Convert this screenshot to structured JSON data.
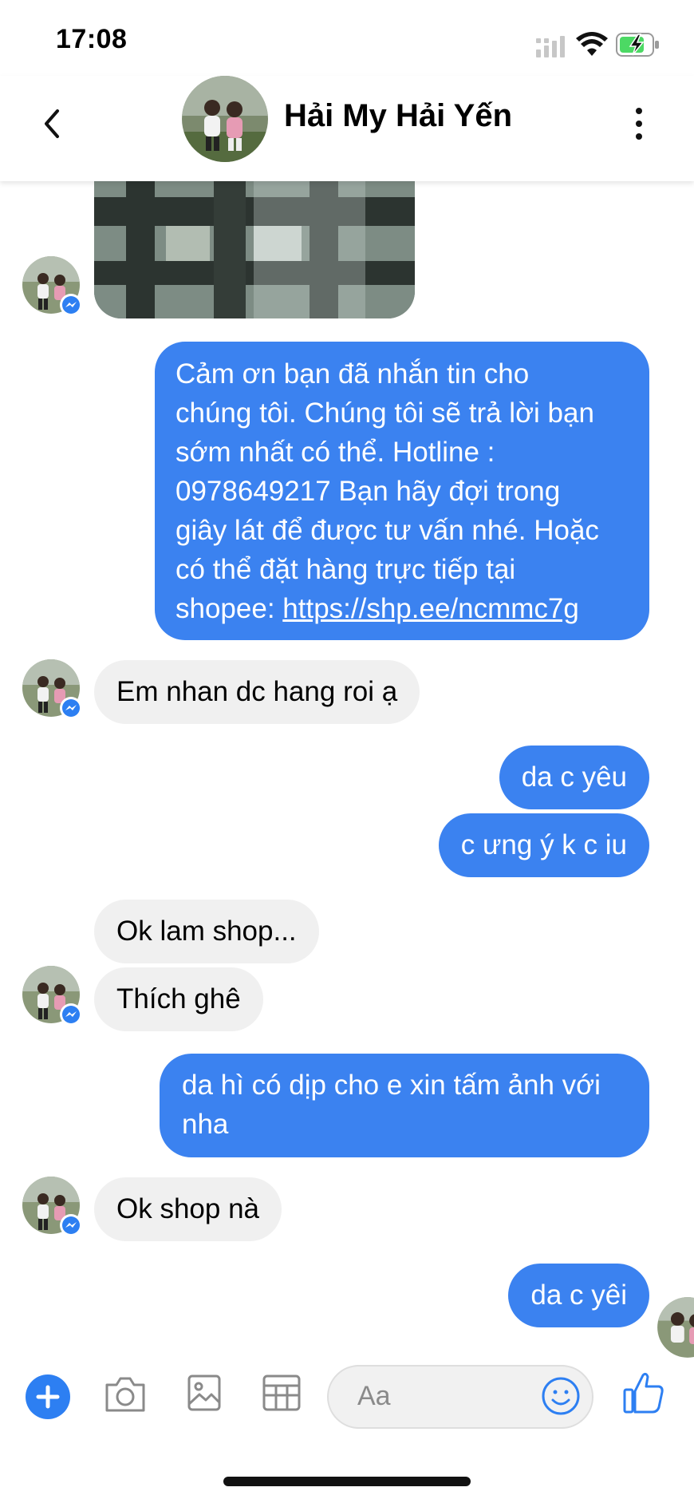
{
  "status": {
    "time": "17:08"
  },
  "header": {
    "title": "Hải My Hải Yến"
  },
  "colors": {
    "accent": "#3b82f0",
    "incoming_bubble": "#f0f0f0",
    "battery_green": "#4cd964"
  },
  "icons": [
    "back-chevron",
    "more-vertical",
    "messenger-badge",
    "plus",
    "camera",
    "image",
    "grid",
    "smile",
    "thumbs-up"
  ],
  "messages": [
    {
      "side": "incoming",
      "kind": "image"
    },
    {
      "side": "outgoing",
      "lines": [
        "Cảm ơn bạn đã nhắn tin cho",
        "chúng tôi. Chúng tôi sẽ trả lời bạn",
        "sớm nhất có thể. Hotline :",
        "0978649217 Bạn hãy đợi trong",
        "giây lát để được tư vấn nhé. Hoặc",
        "có thể đặt hàng trực tiếp tại"
      ],
      "link_prefix": "shopee: ",
      "link": "https://shp.ee/ncmmc7g"
    },
    {
      "side": "incoming",
      "text": "Em nhan dc hang roi ạ"
    },
    {
      "side": "outgoing",
      "text": "da c yêu"
    },
    {
      "side": "outgoing",
      "text": "c ưng ý k c iu"
    },
    {
      "side": "incoming",
      "text": "Ok lam shop..."
    },
    {
      "side": "incoming",
      "text": "Thích ghê"
    },
    {
      "side": "outgoing",
      "lines": [
        "da hì có dịp cho e xin tấm ảnh với",
        "nha"
      ]
    },
    {
      "side": "incoming",
      "text": "Ok shop nà"
    },
    {
      "side": "outgoing",
      "text": "da c yêi"
    }
  ],
  "composer": {
    "placeholder": "Aa"
  }
}
